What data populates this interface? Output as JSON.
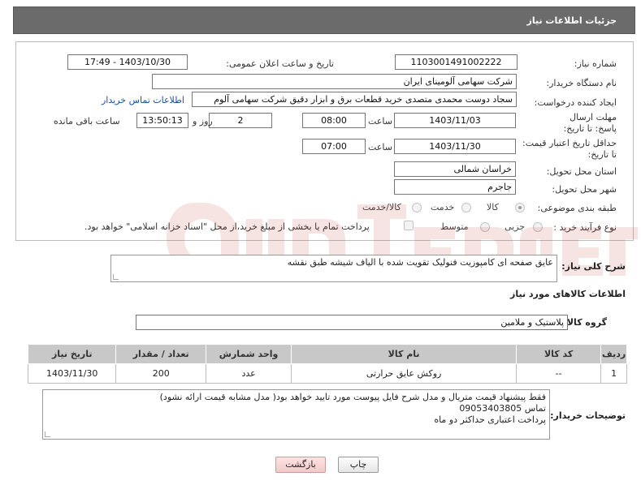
{
  "header": {
    "title": "جزئیات اطلاعات نیاز"
  },
  "form": {
    "need_number": {
      "label": "شماره نیاز:",
      "value": "1103001491002222"
    },
    "announce_datetime": {
      "label": "تاریخ و ساعت اعلان عمومی:",
      "value": "1403/10/30 - 17:49"
    },
    "buyer_org": {
      "label": "نام دستگاه خریدار:",
      "value": "شرکت سهامی آلومینای ایران"
    },
    "requester": {
      "label": "ایجاد کننده درخواست:",
      "value": "سجاد دوست محمدی متصدی خرید قطعات برق و ابزار دقیق شرکت سهامی آلوم",
      "contact_link": "اطلاعات تماس خریدار"
    },
    "reply_deadline": {
      "label": "مهلت ارسال پاسخ: تا تاریخ:",
      "date": "1403/11/03",
      "time_label": "ساعت",
      "time": "08:00",
      "days": "2",
      "days_label": "روز و",
      "remaining": "13:50:13",
      "remaining_label": "ساعت باقی مانده"
    },
    "price_validity": {
      "label": "حداقل تاریخ اعتبار قیمت: تا تاریخ:",
      "date": "1403/11/30",
      "time_label": "ساعت",
      "time": "07:00"
    },
    "delivery_province": {
      "label": "استان محل تحویل:",
      "value": "خراسان شمالی"
    },
    "delivery_city": {
      "label": "شهر محل تحویل:",
      "value": "جاجرم"
    },
    "category": {
      "label": "طبقه بندی موضوعی:",
      "options": [
        "کالا",
        "خدمت",
        "کالا/خدمت"
      ],
      "selected": "کالا"
    },
    "purchase_type": {
      "label": "نوع فرآیند خرید :",
      "options": [
        "جزیی",
        "متوسط"
      ],
      "payment_note": "پرداخت تمام یا بخشی از مبلغ خرید،از محل \"اسناد خزانه اسلامی\" خواهد بود."
    }
  },
  "description": {
    "label": "شرح کلی نیاز:",
    "value": "عایق صفحه ای کامپوزیت فنولیک تقویت شده با الیاف شیشه طبق نقشه"
  },
  "goods_info": {
    "title": "اطلاعات کالاهای مورد نیاز",
    "group_label": "گروه کالا:",
    "group_value": "پلاستیک و ملامین"
  },
  "items_table": {
    "columns": [
      "ردیف",
      "کد کالا",
      "نام کالا",
      "واحد شمارش",
      "تعداد / مقدار",
      "تاریخ نیاز"
    ],
    "rows": [
      {
        "row": "1",
        "code": "--",
        "name": "روکش عایق حرارتی",
        "unit": "عدد",
        "qty": "200",
        "date": "1403/11/30"
      }
    ]
  },
  "buyer_notes": {
    "label": "توضیحات خریدار:",
    "lines": [
      "فقط پیشنهاد قیمت متریال و مدل شرح فایل پیوست مورد تایید خواهد بود( مدل مشابه قیمت ارائه نشود)",
      "تماس 09053403805",
      "پرداخت اعتباری حداکثر دو ماه"
    ]
  },
  "buttons": {
    "print": "چاپ",
    "back": "بازگشت"
  },
  "watermark": {
    "text": "AriaTender.neT"
  },
  "colors": {
    "header_bg": "#6b6b6b",
    "table_header_bg": "#c8c8c8",
    "link": "#1a4fa0",
    "watermark": "#c0392b"
  }
}
